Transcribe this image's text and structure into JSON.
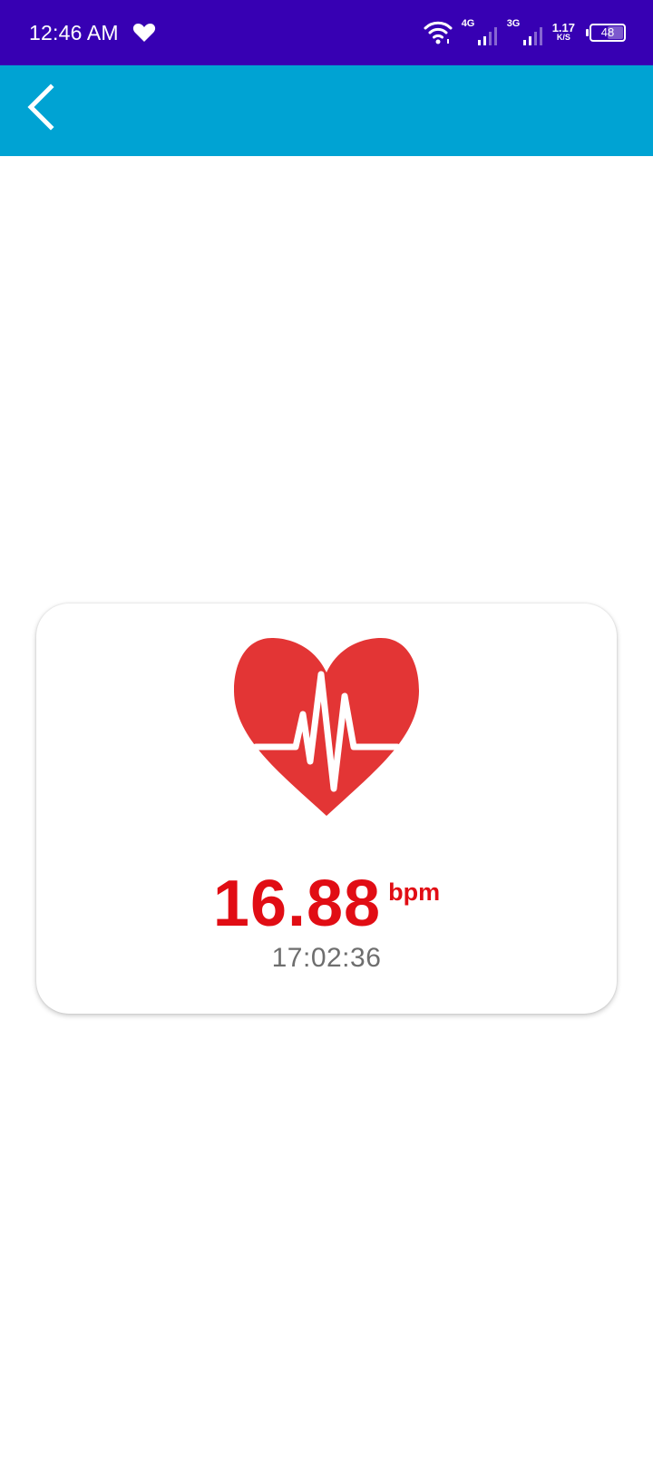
{
  "status_bar": {
    "time": "12:46 AM",
    "network_1": "4G",
    "network_2": "3G",
    "speed_value": "1.17",
    "speed_unit": "K/S",
    "battery": "48",
    "battery_fraction": 0.48,
    "icons": [
      "heart-icon",
      "wifi-icon",
      "signal-4g-icon",
      "signal-3g-icon",
      "battery-icon"
    ],
    "background_color": "#3700b3"
  },
  "app_bar": {
    "background_color": "#00a3d3",
    "back_icon": "chevron-left-icon"
  },
  "heart_rate_card": {
    "icon": "heart-pulse-icon",
    "value": "16.88",
    "unit": "bpm",
    "time": "17:02:36",
    "accent_color": "#e10d14",
    "heart_color": "#e33535"
  }
}
